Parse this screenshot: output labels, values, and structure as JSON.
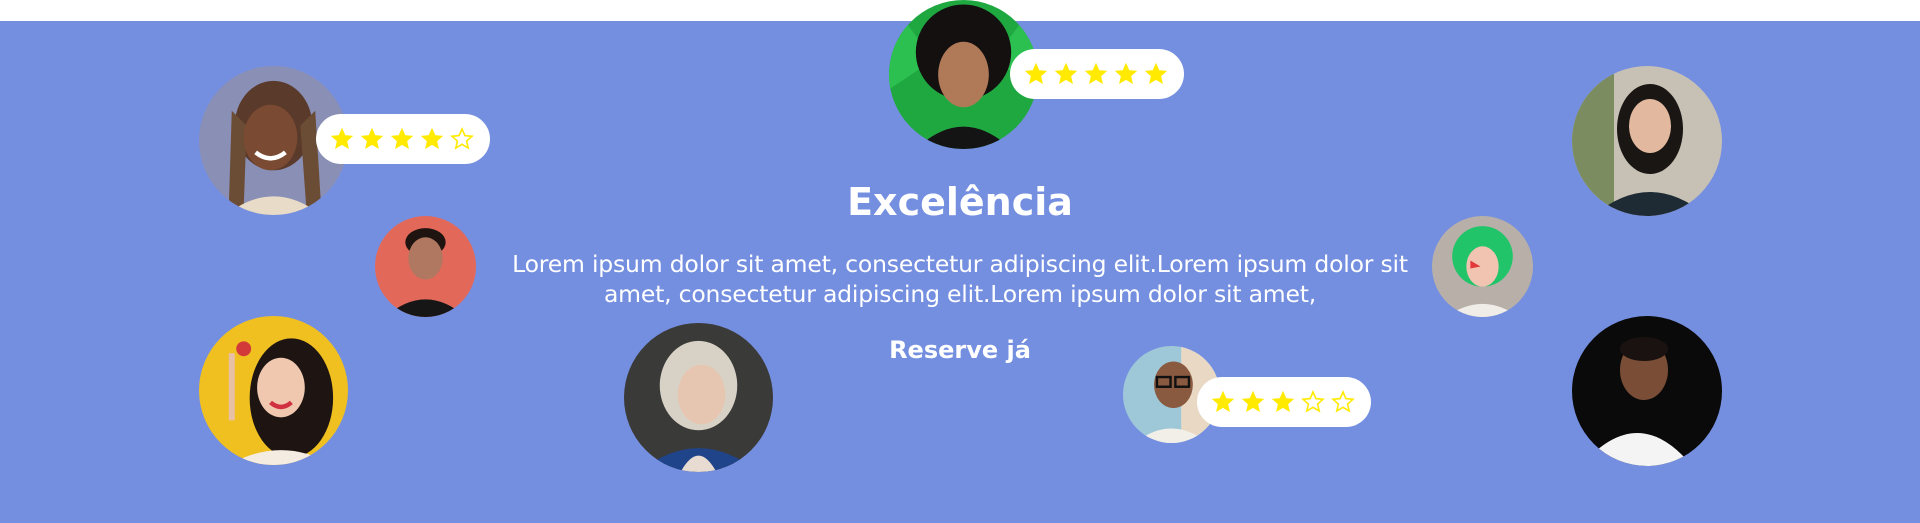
{
  "section": {
    "title": "Excelência",
    "description": "Lorem ipsum dolor sit amet, consectetur adipiscing elit.Lorem ipsum dolor sit amet, consectetur adipiscing elit.Lorem ipsum dolor sit amet,",
    "cta_label": "Reserve já"
  },
  "colors": {
    "background": "#758fe0",
    "star": "#ffea00",
    "text": "#ffffff"
  },
  "ratings": [
    {
      "name": "top-left-reviewer-rating",
      "stars": 4,
      "max": 5
    },
    {
      "name": "top-center-reviewer-rating",
      "stars": 5,
      "max": 5
    },
    {
      "name": "bottom-center-reviewer-rating",
      "stars": 3,
      "max": 5
    }
  ]
}
